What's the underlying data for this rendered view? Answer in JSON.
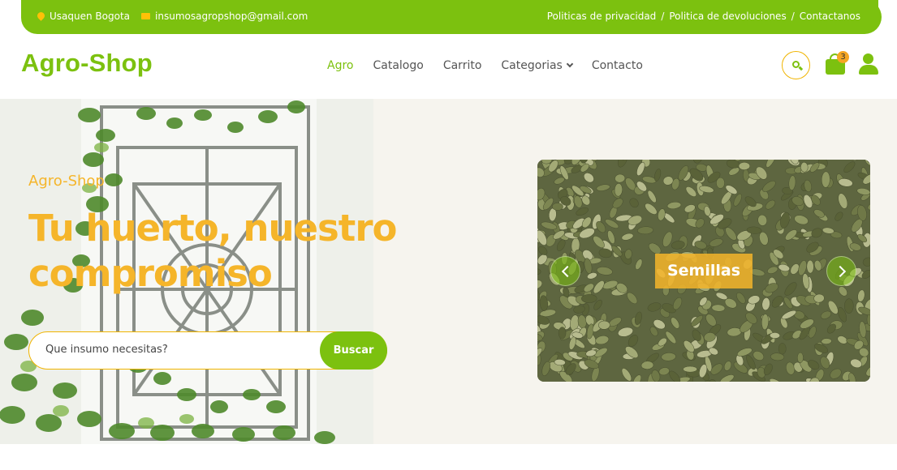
{
  "topbar": {
    "location": "Usaquen Bogota",
    "email": "insumosagropshop@gmail.com",
    "links": [
      "Politicas de privacidad",
      "Politica de devoluciones",
      "Contactanos"
    ],
    "separator": "/"
  },
  "header": {
    "logo": "Agro-Shop",
    "nav": [
      "Agro",
      "Catalogo",
      "Carrito",
      "Categorias",
      "Contacto"
    ],
    "cart_count": "3"
  },
  "hero": {
    "eyebrow": "Agro-Shop",
    "title": "Tu huerto, nuestro compromiso",
    "search_placeholder": "Que insumo necesitas?",
    "search_button": "Buscar"
  },
  "carousel": {
    "slide_label": "Semillas"
  },
  "colors": {
    "brand_green": "#7cc10f",
    "accent_yellow": "#f5b52a",
    "hero_bg": "#f6f4ee"
  }
}
